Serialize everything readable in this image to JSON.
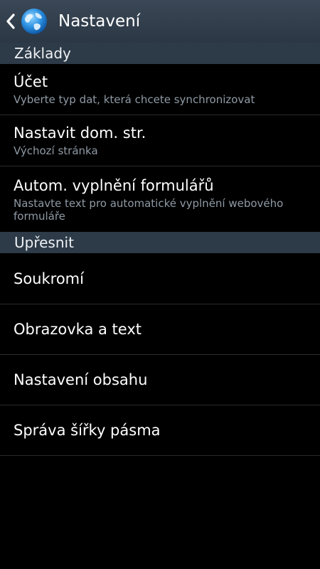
{
  "header": {
    "title": "Nastavení",
    "back_icon": "chevron-left-icon",
    "app_icon": "globe-icon"
  },
  "sections": [
    {
      "label": "Základy",
      "items": [
        {
          "title": "Účet",
          "subtitle": "Vyberte typ dat, která chcete synchronizovat"
        },
        {
          "title": "Nastavit dom. str.",
          "subtitle": "Výchozí stránka"
        },
        {
          "title": "Autom. vyplnění formulářů",
          "subtitle": "Nastavte text pro automatické vyplnění webového formuláře"
        }
      ]
    },
    {
      "label": "Upřesnit",
      "items": [
        {
          "title": "Soukromí"
        },
        {
          "title": "Obrazovka a text"
        },
        {
          "title": "Nastavení obsahu"
        },
        {
          "title": "Správa šířky pásma"
        }
      ]
    }
  ],
  "colors": {
    "action_bar": "#2b3744",
    "section_header": "#2d3a47",
    "subtitle": "#8f9aa5"
  }
}
